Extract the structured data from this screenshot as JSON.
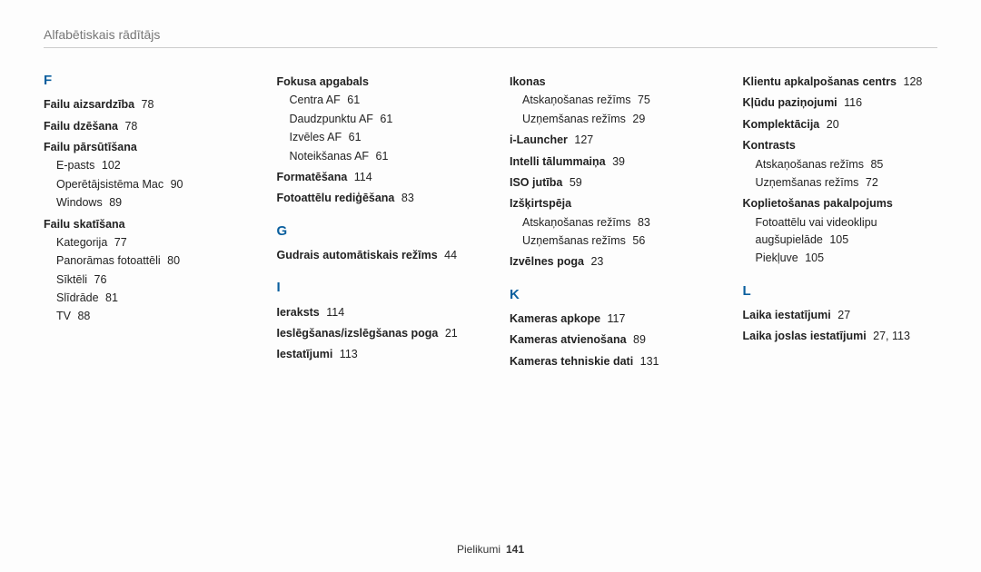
{
  "header": "Alfabētiskais rādītājs",
  "footer": {
    "label": "Pielikumi",
    "page": "141"
  },
  "columns": [
    [
      {
        "type": "letter",
        "text": "F"
      },
      {
        "type": "entry",
        "text": "Failu aizsardzība",
        "page": "78"
      },
      {
        "type": "entry",
        "text": "Failu dzēšana",
        "page": "78"
      },
      {
        "type": "entry",
        "text": "Failu pārsūtīšana"
      },
      {
        "type": "sub",
        "text": "E-pasts",
        "page": "102"
      },
      {
        "type": "sub",
        "text": "Operētājsistēma Mac",
        "page": "90"
      },
      {
        "type": "sub",
        "text": "Windows",
        "page": "89"
      },
      {
        "type": "entry",
        "text": "Failu skatīšana"
      },
      {
        "type": "sub",
        "text": "Kategorija",
        "page": "77"
      },
      {
        "type": "sub",
        "text": "Panorāmas fotoattēli",
        "page": "80"
      },
      {
        "type": "sub",
        "text": "Sīktēli",
        "page": "76"
      },
      {
        "type": "sub",
        "text": "Slīdrāde",
        "page": "81"
      },
      {
        "type": "sub",
        "text": "TV",
        "page": "88"
      }
    ],
    [
      {
        "type": "entry",
        "text": "Fokusa apgabals"
      },
      {
        "type": "sub",
        "text": "Centra AF",
        "page": "61"
      },
      {
        "type": "sub",
        "text": "Daudzpunktu AF",
        "page": "61"
      },
      {
        "type": "sub",
        "text": "Izvēles AF",
        "page": "61"
      },
      {
        "type": "sub",
        "text": "Noteikšanas AF",
        "page": "61"
      },
      {
        "type": "entry",
        "text": "Formatēšana",
        "page": "114"
      },
      {
        "type": "entry",
        "text": "Fotoattēlu rediģēšana",
        "page": "83"
      },
      {
        "type": "letter",
        "text": "G"
      },
      {
        "type": "entry",
        "text": "Gudrais automātiskais režīms",
        "page": "44"
      },
      {
        "type": "letter",
        "text": "I"
      },
      {
        "type": "entry",
        "text": "Ieraksts",
        "page": "114"
      },
      {
        "type": "entry",
        "text": "Ieslēgšanas/izslēgšanas poga",
        "page": "21"
      },
      {
        "type": "entry",
        "text": "Iestatījumi",
        "page": "113"
      }
    ],
    [
      {
        "type": "entry",
        "text": "Ikonas"
      },
      {
        "type": "sub",
        "text": "Atskaņošanas režīms",
        "page": "75"
      },
      {
        "type": "sub",
        "text": "Uzņemšanas režīms",
        "page": "29"
      },
      {
        "type": "entry",
        "text": "i-Launcher",
        "page": "127"
      },
      {
        "type": "entry",
        "text": "Intelli tālummaiņa",
        "page": "39"
      },
      {
        "type": "entry",
        "text": "ISO jutība",
        "page": "59"
      },
      {
        "type": "entry",
        "text": "Izšķirtspēja"
      },
      {
        "type": "sub",
        "text": "Atskaņošanas režīms",
        "page": "83"
      },
      {
        "type": "sub",
        "text": "Uzņemšanas režīms",
        "page": "56"
      },
      {
        "type": "entry",
        "text": "Izvēlnes poga",
        "page": "23"
      },
      {
        "type": "letter",
        "text": "K"
      },
      {
        "type": "entry",
        "text": "Kameras apkope",
        "page": "117"
      },
      {
        "type": "entry",
        "text": "Kameras atvienošana",
        "page": "89"
      },
      {
        "type": "entry",
        "text": "Kameras tehniskie dati",
        "page": "131"
      }
    ],
    [
      {
        "type": "entry",
        "text": "Klientu apkalpošanas centrs",
        "page": "128"
      },
      {
        "type": "entry",
        "text": "Kļūdu paziņojumi",
        "page": "116"
      },
      {
        "type": "entry",
        "text": "Komplektācija",
        "page": "20"
      },
      {
        "type": "entry",
        "text": "Kontrasts"
      },
      {
        "type": "sub",
        "text": "Atskaņošanas režīms",
        "page": "85"
      },
      {
        "type": "sub",
        "text": "Uzņemšanas režīms",
        "page": "72"
      },
      {
        "type": "entry",
        "text": "Koplietošanas pakalpojums"
      },
      {
        "type": "sub",
        "text": "Fotoattēlu vai videoklipu augšupielāde",
        "page": "105"
      },
      {
        "type": "sub",
        "text": "Piekļuve",
        "page": "105"
      },
      {
        "type": "letter",
        "text": "L"
      },
      {
        "type": "entry",
        "text": "Laika iestatījumi",
        "page": "27"
      },
      {
        "type": "entry",
        "text": "Laika joslas iestatījumi",
        "page": "27, 113"
      }
    ]
  ]
}
